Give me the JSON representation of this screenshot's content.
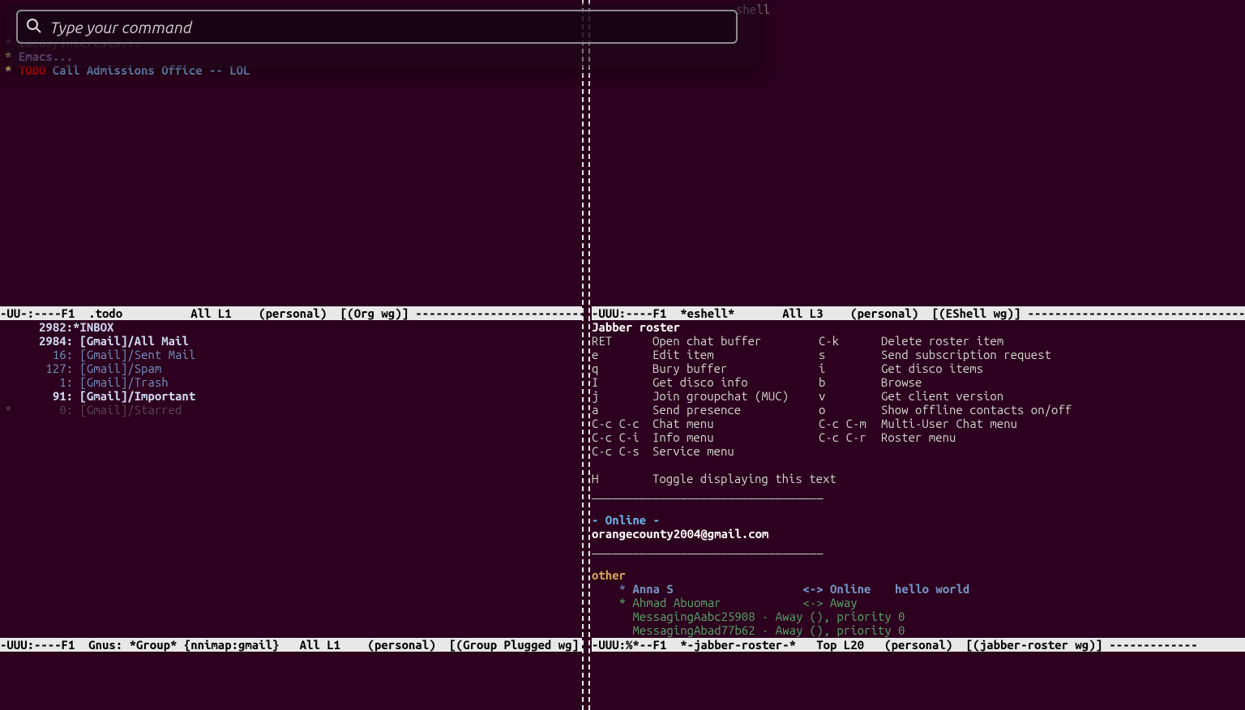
{
  "hud": {
    "placeholder": "Type your command"
  },
  "title_hint": "shell",
  "todo": {
    "l1_head": "Ideas/Interests...",
    "l2_star": "*",
    "l2_head": "Emacs...",
    "l3_star": "*",
    "l3_todo": "TODO",
    "l3_rest": "Call Admissions Office -- LOL"
  },
  "groups": {
    "l1_count": "2982:",
    "l1_name": "*INBOX",
    "l2_count": "2984:",
    "l2_name": "[Gmail]/All Mail",
    "l3_count": "16:",
    "l3_name": "[Gmail]/Sent Mail",
    "l4_count": "127:",
    "l4_name": "[Gmail]/Spam",
    "l5_count": "1:",
    "l5_name": "[Gmail]/Trash",
    "l6_count": "91:",
    "l6_name": "[Gmail]/Important",
    "l7_star": "*",
    "l7_count": "0:",
    "l7_name": "[Gmail]/Starred"
  },
  "jabber": {
    "title": "Jabber roster",
    "k1a": "RET",
    "d1a": "Open chat buffer",
    "k1b": "C-k",
    "d1b": "Delete roster item",
    "k2a": "e",
    "d2a": "Edit item",
    "k2b": "s",
    "d2b": "Send subscription request",
    "k3a": "q",
    "d3a": "Bury buffer",
    "k3b": "i",
    "d3b": "Get disco items",
    "k4a": "I",
    "d4a": "Get disco info",
    "k4b": "b",
    "d4b": "Browse",
    "k5a": "j",
    "d5a": "Join groupchat (MUC)",
    "k5b": "v",
    "d5b": "Get client version",
    "k6a": "a",
    "d6a": "Send presence",
    "k6b": "o",
    "d6b": "Show offline contacts on/off",
    "k7a": "C-c C-c",
    "d7a": "Chat menu",
    "k7b": "C-c C-m",
    "d7b": "Multi-User Chat menu",
    "k8a": "C-c C-i",
    "d8a": "Info menu",
    "k8b": "C-c C-r",
    "d8b": "Roster menu",
    "k9a": "C-c C-s",
    "d9a": "Service menu",
    "k10a": "H",
    "d10a": "Toggle displaying this text",
    "rule": "__________________________________",
    "online_head": " - Online -",
    "account": "orangecounty2004@gmail.com",
    "group_other": "other",
    "c1_star": "*",
    "c1_name": "Anna S",
    "c1_arrows": "<->",
    "c1_status": "Online",
    "c1_msg": "hello world",
    "c2_star": "*",
    "c2_name": "Ahmad Abuomar",
    "c2_arrows": "<->",
    "c2_status": "Away",
    "c3_line": "MessagingAabc25908 - Away (), priority 0",
    "c4_line": "MessagingAbad77b62 - Away (), priority 0"
  },
  "modelines": {
    "tl": "-UU-:----F1  .todo          All L1    (personal)  [(Org wg)] ---------------------------",
    "tr": "-UUU:----F1  *eshell*       All L3    (personal)  [(EShell wg)] ---------------------------------------------------------------------------------",
    "bl": "-UUU:----F1  Gnus: *Group* {nnimap:gmail}   All L1    (personal)  [(Group Plugged wg]",
    "br": "-UUU:%*--F1  *-jabber-roster-*   Top L20   (personal)  [(jabber-roster wg)] -------------"
  }
}
